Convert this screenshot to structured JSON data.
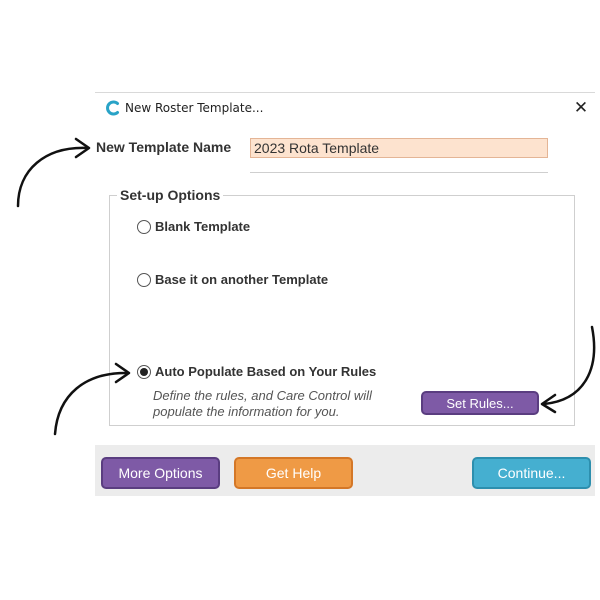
{
  "dialog": {
    "title": "New Roster Template...",
    "close_label": "✕",
    "app_icon": "care-control-c-icon"
  },
  "template_name": {
    "label": "New Template Name",
    "value": "2023 Rota Template"
  },
  "setup": {
    "legend": "Set-up Options",
    "options": [
      {
        "label": "Blank Template",
        "selected": false
      },
      {
        "label": "Base it on another Template",
        "selected": false
      },
      {
        "label": "Auto Populate Based on Your Rules",
        "selected": true
      }
    ],
    "description_line1": "Define the rules, and Care Control will",
    "description_line2": "populate the information for you.",
    "set_rules_label": "Set Rules..."
  },
  "footer": {
    "more_options_label": "More Options",
    "get_help_label": "Get Help",
    "continue_label": "Continue..."
  },
  "colors": {
    "accent_purple": "#7e5aa6",
    "accent_orange": "#ef9a45",
    "accent_blue": "#45afd0",
    "input_bg": "#fde3cf",
    "brand_icon": "#29a3c7"
  }
}
